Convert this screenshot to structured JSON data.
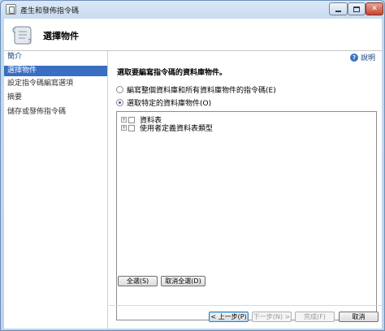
{
  "window": {
    "title": "產生和發佈指令碼",
    "close_glyph": "✕"
  },
  "header": {
    "title": "選擇物件",
    "icon": "scroll-icon"
  },
  "sidebar": {
    "heading": "簡介",
    "items": [
      {
        "label": "選擇物件",
        "active": true
      },
      {
        "label": "設定指令碼編寫選項",
        "active": false
      },
      {
        "label": "摘要",
        "active": false
      },
      {
        "label": "儲存或發佈指令碼",
        "active": false
      }
    ]
  },
  "main": {
    "help_label": "說明",
    "help_icon_glyph": "?",
    "section_title": "選取要編寫指令碼的資料庫物件。",
    "radio_options": [
      {
        "label": "編寫整個資料庫和所有資料庫物件的指令碼(E)",
        "checked": false
      },
      {
        "label": "選取特定的資料庫物件(O)",
        "checked": true
      }
    ],
    "tree_items": [
      {
        "expander": "+",
        "label": "資料表"
      },
      {
        "expander": "+",
        "label": "使用者定義資料表類型"
      }
    ],
    "select_all_label": "全選(S)",
    "deselect_all_label": "取消全選(D)"
  },
  "footer": {
    "prev_label": "< 上一步(P)",
    "next_label": "下一步(N) >",
    "finish_label": "完成(F)",
    "cancel_label": "取消"
  },
  "colors": {
    "selected_item": "#3a6ec2",
    "title_bar": "#c7d9ee",
    "link": "#1f3f7f"
  }
}
